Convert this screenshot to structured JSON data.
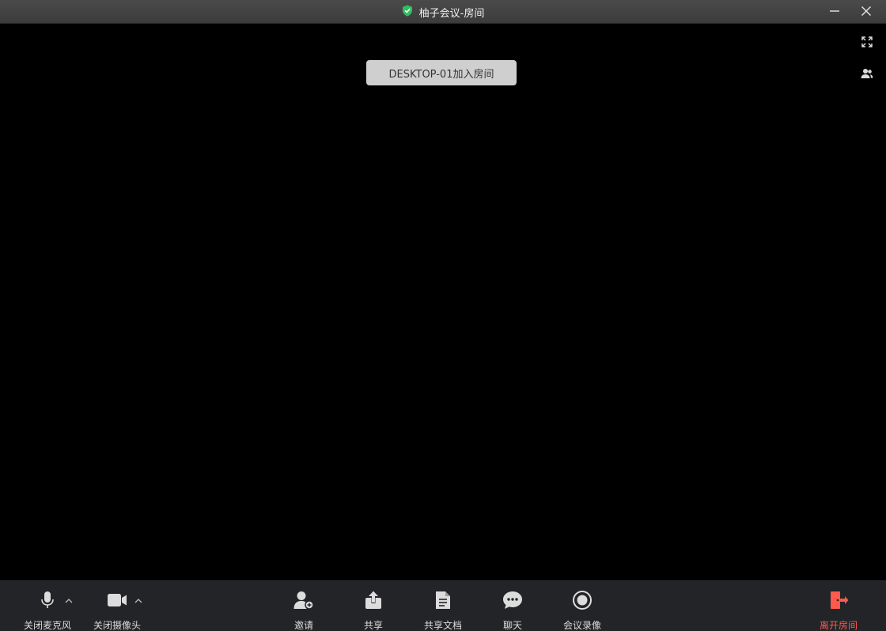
{
  "window": {
    "title": "柚子会议-房间",
    "icons": {
      "shield": "shield-check-icon",
      "minimize": "minimize-icon",
      "close": "close-icon"
    },
    "shield_color": "#2fbf5f"
  },
  "stage": {
    "notification": "DESKTOP-01加入房间",
    "side_buttons": {
      "fullscreen": "fullscreen-icon",
      "members": "members-icon"
    }
  },
  "toolbar": {
    "mic": {
      "label": "关闭麦克风",
      "icon": "microphone-icon"
    },
    "camera": {
      "label": "关闭摄像头",
      "icon": "video-camera-icon"
    },
    "invite": {
      "label": "邀请",
      "icon": "invite-user-icon"
    },
    "share": {
      "label": "共享",
      "icon": "share-upload-icon"
    },
    "share_doc": {
      "label": "共享文档",
      "icon": "document-icon"
    },
    "chat": {
      "label": "聊天",
      "icon": "chat-bubble-icon"
    },
    "record": {
      "label": "会议录像",
      "icon": "record-icon"
    },
    "leave": {
      "label": "离开房间",
      "icon": "exit-door-icon",
      "color": "#ff5a4e"
    }
  }
}
